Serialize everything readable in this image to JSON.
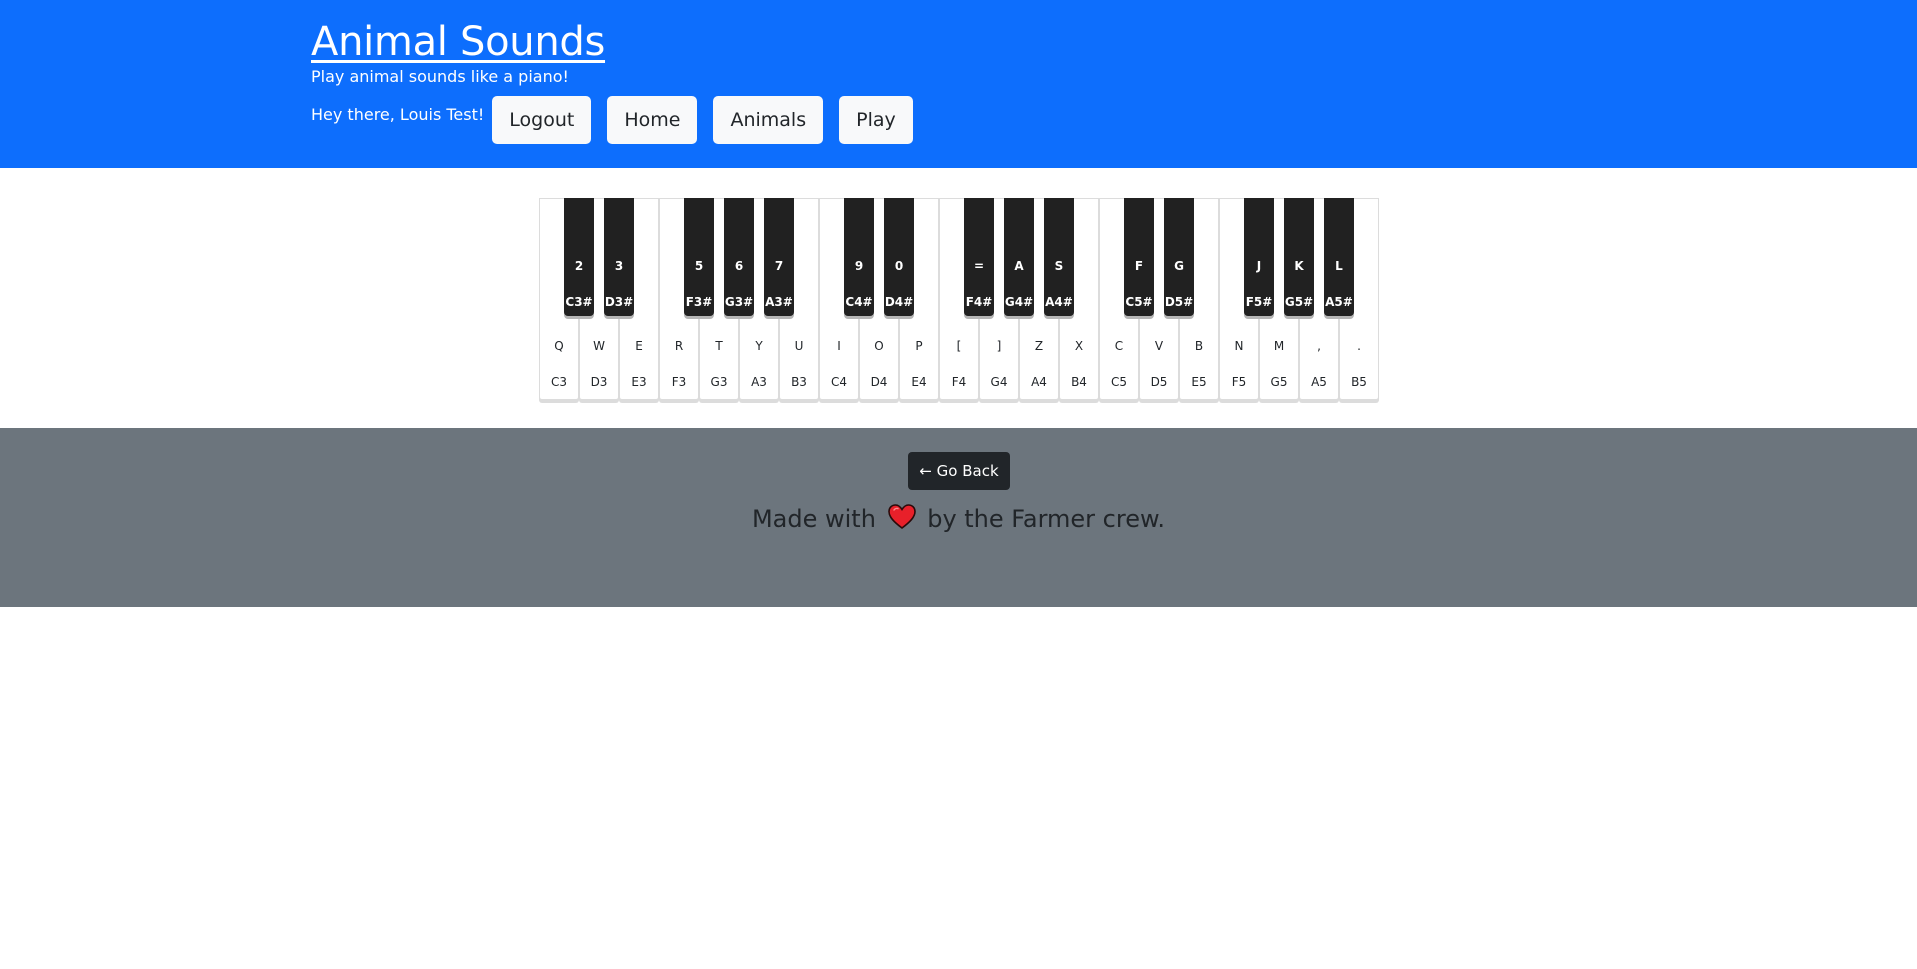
{
  "header": {
    "title": "Animal Sounds",
    "subtitle": "Play animal sounds like a piano!",
    "greeting": "Hey there, Louis Test!",
    "nav": {
      "logout": "Logout",
      "home": "Home",
      "animals": "Animals",
      "play": "Play"
    }
  },
  "piano": {
    "white_keys": [
      {
        "key": "Q",
        "note": "C3"
      },
      {
        "key": "W",
        "note": "D3"
      },
      {
        "key": "E",
        "note": "E3"
      },
      {
        "key": "R",
        "note": "F3"
      },
      {
        "key": "T",
        "note": "G3"
      },
      {
        "key": "Y",
        "note": "A3"
      },
      {
        "key": "U",
        "note": "B3"
      },
      {
        "key": "I",
        "note": "C4"
      },
      {
        "key": "O",
        "note": "D4"
      },
      {
        "key": "P",
        "note": "E4"
      },
      {
        "key": "[",
        "note": "F4"
      },
      {
        "key": "]",
        "note": "G4"
      },
      {
        "key": "Z",
        "note": "A4"
      },
      {
        "key": "X",
        "note": "B4"
      },
      {
        "key": "C",
        "note": "C5"
      },
      {
        "key": "V",
        "note": "D5"
      },
      {
        "key": "B",
        "note": "E5"
      },
      {
        "key": "N",
        "note": "F5"
      },
      {
        "key": "M",
        "note": "G5"
      },
      {
        "key": ",",
        "note": "A5"
      },
      {
        "key": ".",
        "note": "B5"
      }
    ],
    "black_keys": [
      {
        "key": "2",
        "note": "C3#"
      },
      {
        "key": "3",
        "note": "D3#"
      },
      {
        "key": "5",
        "note": "F3#"
      },
      {
        "key": "6",
        "note": "G3#"
      },
      {
        "key": "7",
        "note": "A3#"
      },
      {
        "key": "9",
        "note": "C4#"
      },
      {
        "key": "0",
        "note": "D4#"
      },
      {
        "key": "=",
        "note": "F4#"
      },
      {
        "key": "A",
        "note": "G4#"
      },
      {
        "key": "S",
        "note": "A4#"
      },
      {
        "key": "F",
        "note": "C5#"
      },
      {
        "key": "G",
        "note": "D5#"
      },
      {
        "key": "J",
        "note": "F5#"
      },
      {
        "key": "K",
        "note": "G5#"
      },
      {
        "key": "L",
        "note": "A5#"
      }
    ]
  },
  "footer": {
    "go_back": "← Go Back",
    "made_with_prefix": "Made with",
    "made_with_suffix": "by the Farmer crew.",
    "heart_icon": "heart-icon"
  },
  "colors": {
    "header_bg": "#0d6efd",
    "footer_bg": "#6c757d",
    "black_key": "#212121",
    "go_back_bg": "#212529",
    "heart": "#e8202a"
  }
}
